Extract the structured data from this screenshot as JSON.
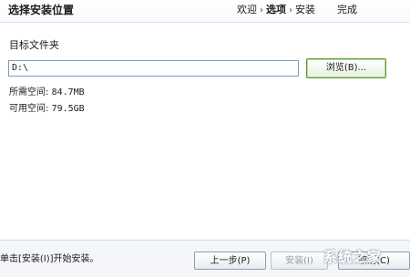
{
  "header": {
    "title": "选择安装位置",
    "steps": [
      {
        "label": "欢迎",
        "active": false
      },
      {
        "label": "选项",
        "active": true
      },
      {
        "label": "安装",
        "active": false
      },
      {
        "label": "完成",
        "active": false
      }
    ],
    "separator": "›"
  },
  "content": {
    "folder_label": "目标文件夹",
    "path_value": "D:\\",
    "browse_label": "浏览(B)...",
    "required_space": {
      "label": "所需空间:",
      "value": "84.7MB"
    },
    "available_space": {
      "label": "可用空间:",
      "value": "79.5GB"
    }
  },
  "footer": {
    "note": "单击[安装(I)]开始安装。",
    "prev_label": "上一步(P)",
    "install_label": "安装(I)",
    "finish_label": "取消(C)",
    "watermark": "系统之家"
  },
  "colors": {
    "input_border": "#7f9db9",
    "browse_border": "#5a9a3a",
    "footer_bg": "#f4f6f9"
  }
}
